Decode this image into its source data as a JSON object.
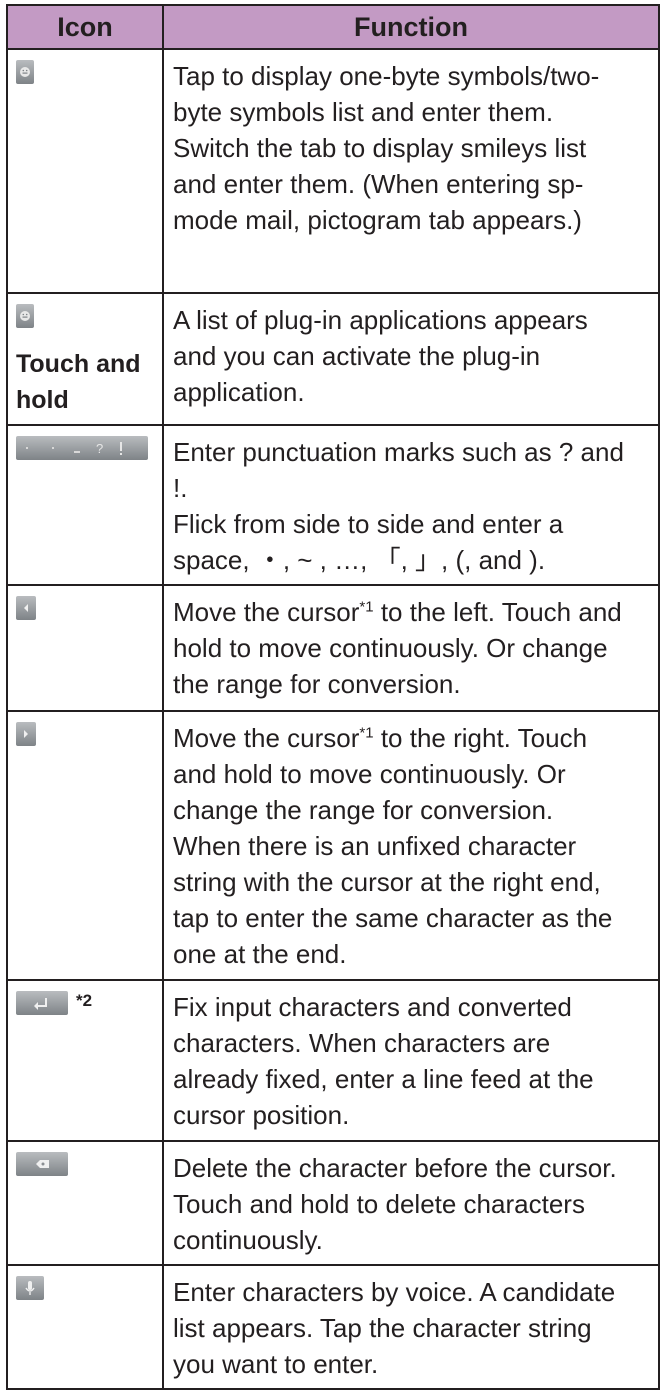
{
  "headers": {
    "icon": "Icon",
    "function": "Function"
  },
  "rows": [
    {
      "icon": "emoticon-key-icon",
      "lines": [
        "Tap to display one-byte symbols/two-",
        "byte symbols list and enter them.",
        "Switch the tab to display smileys list",
        "and enter them. (When entering sp-",
        "mode mail, pictogram tab appears.)"
      ]
    },
    {
      "icon": "emoticon-key-icon",
      "icon_note": [
        "Touch and",
        "hold"
      ],
      "lines": [
        "A list of plug-in applications appears",
        "and you can activate the plug-in",
        "application."
      ]
    },
    {
      "icon": "punctuation-key-icon",
      "lines": [
        "Enter punctuation marks such as ? and",
        "!.",
        "Flick from side to side and enter a",
        "space, ・, ~ , …, 「, 」, (, and )."
      ]
    },
    {
      "icon": "cursor-left-key-icon",
      "parts": [
        "Move the cursor",
        "*1",
        " to the left. Touch and"
      ],
      "lines": [
        "hold to move continuously. Or change",
        "the range for conversion."
      ]
    },
    {
      "icon": "cursor-right-key-icon",
      "parts": [
        "Move the cursor",
        "*1",
        " to the right. Touch"
      ],
      "lines": [
        "and hold to move continuously. Or",
        "change the range for conversion.",
        "When there is an unfixed character",
        "string with the cursor at the right end,",
        "tap to enter the same character as the",
        "one at the end."
      ]
    },
    {
      "icon": "enter-key-icon",
      "icon_sup": "*2",
      "lines": [
        "Fix input characters and converted",
        "characters. When characters are",
        "already fixed, enter a line feed at the",
        "cursor position."
      ]
    },
    {
      "icon": "delete-key-icon",
      "lines": [
        "Delete the character before the cursor.",
        "Touch and hold to delete characters",
        "continuously."
      ]
    },
    {
      "icon": "microphone-key-icon",
      "lines": [
        "Enter characters by voice. A candidate",
        "list appears. Tap the character string",
        "you want to enter."
      ]
    }
  ]
}
